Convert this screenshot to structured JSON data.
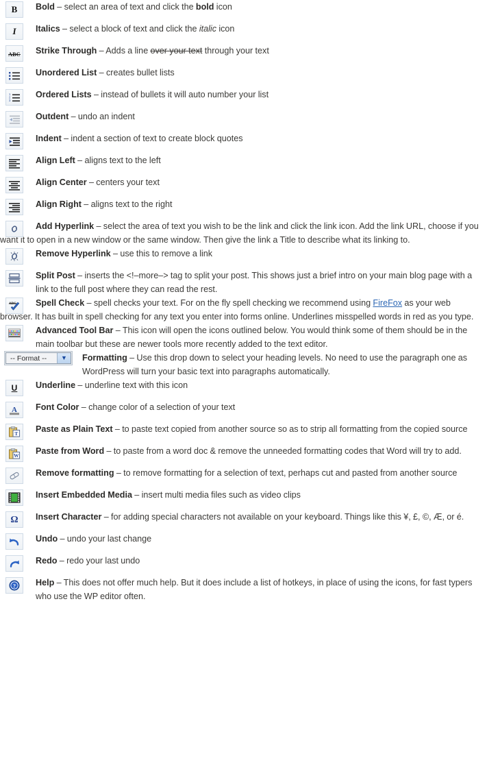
{
  "page": {
    "title": "WordPress Visual Editor Toolbar Icon Reference",
    "background": "#ffffff",
    "text_color": "#3b3a37",
    "link_color": "#2b66b4",
    "icon_border_color": "#cfdae6"
  },
  "rows": [
    {
      "id": "bold",
      "icon": "bold-icon",
      "term": "Bold",
      "dash": " – ",
      "lines": [
        {
          "segments": [
            {
              "text": "select an area of text and click the "
            },
            {
              "text": "bold",
              "style": "bold"
            },
            {
              "text": " icon"
            }
          ]
        }
      ]
    },
    {
      "id": "italics",
      "icon": "italic-icon",
      "term": "Italics",
      "dash": " – ",
      "lines": [
        {
          "segments": [
            {
              "text": "select a block of text and click the "
            },
            {
              "text": "italic",
              "style": "italic"
            },
            {
              "text": " icon"
            }
          ]
        }
      ]
    },
    {
      "id": "strike-through",
      "icon": "strikethrough-icon",
      "term": "Strike Through",
      "dash": " – ",
      "lines": [
        {
          "segments": [
            {
              "text": "Adds a line "
            },
            {
              "text": "over your text",
              "style": "strike"
            },
            {
              "text": " through your text"
            }
          ]
        }
      ]
    },
    {
      "id": "unordered-list",
      "icon": "bullet-list-icon",
      "term": "Unordered List",
      "dash": " – ",
      "lines": [
        {
          "segments": [
            {
              "text": "creates bullet lists"
            }
          ]
        }
      ]
    },
    {
      "id": "ordered-lists",
      "icon": "numbered-list-icon",
      "term": "Ordered Lists",
      "dash": " – ",
      "lines": [
        {
          "segments": [
            {
              "text": "instead of bullets it will auto number your list"
            }
          ]
        }
      ]
    },
    {
      "id": "outdent",
      "icon": "outdent-icon",
      "term": "Outdent",
      "dash": " – ",
      "lines": [
        {
          "segments": [
            {
              "text": "undo an indent"
            }
          ]
        }
      ]
    },
    {
      "id": "indent",
      "icon": "indent-icon",
      "term": "Indent",
      "dash": " – ",
      "lines": [
        {
          "segments": [
            {
              "text": "indent a section of text to create block quotes"
            }
          ]
        }
      ]
    },
    {
      "id": "align-left",
      "icon": "align-left-icon",
      "term": "Align Left",
      "dash": " – ",
      "lines": [
        {
          "segments": [
            {
              "text": "aligns text to the left"
            }
          ]
        }
      ]
    },
    {
      "id": "align-center",
      "icon": "align-center-icon",
      "term": "Align Center",
      "dash": " – ",
      "lines": [
        {
          "segments": [
            {
              "text": "centers your text"
            }
          ]
        }
      ]
    },
    {
      "id": "align-right",
      "icon": "align-right-icon",
      "term": "Align Right",
      "dash": " – ",
      "lines": [
        {
          "segments": [
            {
              "text": "aligns text to the right"
            }
          ]
        }
      ]
    },
    {
      "id": "add-hyperlink",
      "icon": "link-icon",
      "term": "Add Hyperlink",
      "dash": " – ",
      "hanging": true,
      "lines": [
        {
          "segments": [
            {
              "text": "select the area of text you wish to be the link and click the link icon. Add the link URL, choose if you want it to open in a new window or the same window. Then give the link a Title to describe what its linking to."
            }
          ]
        }
      ]
    },
    {
      "id": "remove-hyperlink",
      "icon": "unlink-icon",
      "term": "Remove Hyperlink",
      "dash": " – ",
      "lines": [
        {
          "segments": [
            {
              "text": "use this to remove a link"
            }
          ]
        }
      ]
    },
    {
      "id": "split-post",
      "icon": "split-post-icon",
      "term": "Split Post",
      "dash": " – ",
      "lines": [
        {
          "segments": [
            {
              "text": "inserts the <!–more–> tag to split your post. This shows just a brief intro on your main blog page with a link to the full post where they can read the rest."
            }
          ]
        }
      ]
    },
    {
      "id": "spell-check",
      "icon": "spellcheck-icon",
      "term": "Spell Check",
      "dash": " – ",
      "hanging": true,
      "lines": [
        {
          "segments": [
            {
              "text": "spell checks your text. For on the fly spell checking we recommend using "
            },
            {
              "text": "FireFox",
              "style": "link"
            },
            {
              "text": " as your web browser. It has built in spell checking for any text you enter into forms online. Underlines misspelled words in red as you type."
            }
          ]
        }
      ]
    },
    {
      "id": "advanced-tool-bar",
      "icon": "advanced-toolbar-icon",
      "term": "Advanced Tool Bar",
      "dash": " – ",
      "lines": [
        {
          "segments": [
            {
              "text": "This icon will open the icons outlined below. You would think some of them should be in the main toolbar but these are newer tools more recently added to the text editor."
            }
          ]
        }
      ]
    },
    {
      "id": "formatting",
      "icon": "format-dropdown",
      "control": "select",
      "select_value": "-- Format --",
      "term": "Formatting",
      "dash": " – ",
      "lines": [
        {
          "segments": [
            {
              "text": "Use this drop down to select your heading levels. No need to use the paragraph one as WordPress will turn your basic text into paragraphs automatically."
            }
          ]
        }
      ]
    },
    {
      "id": "underline",
      "icon": "underline-icon",
      "term": "Underline",
      "dash": " – ",
      "lines": [
        {
          "segments": [
            {
              "text": "underline text with this icon"
            }
          ]
        }
      ]
    },
    {
      "id": "font-color",
      "icon": "font-color-icon",
      "term": "Font Color",
      "dash": " – ",
      "lines": [
        {
          "segments": [
            {
              "text": "change color of a selection of your text"
            }
          ]
        }
      ]
    },
    {
      "id": "paste-as-plain-text",
      "icon": "paste-plain-text-icon",
      "term": "Paste as Plain Text",
      "dash": " – ",
      "lines": [
        {
          "segments": [
            {
              "text": "to paste text copied from another source so as to strip all formatting from the copied source"
            }
          ]
        }
      ]
    },
    {
      "id": "paste-from-word",
      "icon": "paste-from-word-icon",
      "term": "Paste from Word",
      "dash": " – ",
      "lines": [
        {
          "segments": [
            {
              "text": "to paste from a word doc & remove the unneeded formatting codes that Word will try to add."
            }
          ]
        }
      ]
    },
    {
      "id": "remove-formatting",
      "icon": "eraser-icon",
      "term": "Remove formatting",
      "dash": " – ",
      "lines": [
        {
          "segments": [
            {
              "text": "to remove formatting for a selection of text, perhaps cut and pasted from another source"
            }
          ]
        }
      ]
    },
    {
      "id": "insert-embedded-media",
      "icon": "media-icon",
      "term": "Insert Embedded Media",
      "dash": " – ",
      "lines": [
        {
          "segments": [
            {
              "text": "insert multi media files such as video clips"
            }
          ]
        }
      ]
    },
    {
      "id": "insert-character",
      "icon": "omega-icon",
      "term": "Insert Character",
      "dash": " – ",
      "lines": [
        {
          "segments": [
            {
              "text": "for adding special characters not available on your keyboard. Things like this ¥, £, ©, Æ, or é."
            }
          ]
        }
      ]
    },
    {
      "id": "undo",
      "icon": "undo-icon",
      "term": "Undo",
      "dash": " – ",
      "lines": [
        {
          "segments": [
            {
              "text": "undo your last change"
            }
          ]
        }
      ]
    },
    {
      "id": "redo",
      "icon": "redo-icon",
      "term": "Redo",
      "dash": " – ",
      "lines": [
        {
          "segments": [
            {
              "text": "redo your last undo"
            }
          ]
        }
      ]
    },
    {
      "id": "help",
      "icon": "help-icon",
      "term": "Help",
      "dash": " – ",
      "lines": [
        {
          "segments": [
            {
              "text": "This does not offer much help. But it does include a list of hotkeys, in place of using the icons, for fast typers who use the WP editor often."
            }
          ]
        }
      ]
    }
  ]
}
